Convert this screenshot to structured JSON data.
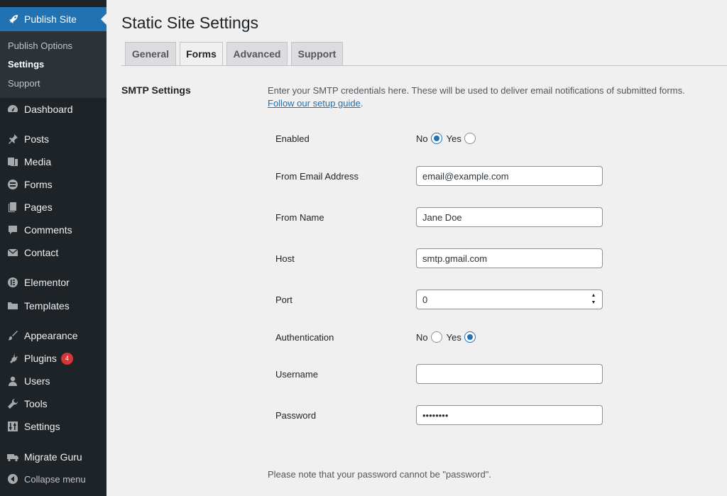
{
  "sidebar": {
    "current": {
      "label": "Publish Site",
      "icon": "rocket-icon"
    },
    "submenu": [
      "Publish Options",
      "Settings",
      "Support"
    ],
    "items": [
      {
        "label": "Dashboard",
        "icon": "dashboard-icon"
      },
      {
        "label": "Posts",
        "icon": "pin-icon"
      },
      {
        "label": "Media",
        "icon": "media-icon"
      },
      {
        "label": "Forms",
        "icon": "forms-icon"
      },
      {
        "label": "Pages",
        "icon": "pages-icon"
      },
      {
        "label": "Comments",
        "icon": "comment-icon"
      },
      {
        "label": "Contact",
        "icon": "mail-icon"
      },
      {
        "label": "Elementor",
        "icon": "elementor-icon"
      },
      {
        "label": "Templates",
        "icon": "folder-icon"
      },
      {
        "label": "Appearance",
        "icon": "brush-icon"
      },
      {
        "label": "Plugins",
        "icon": "plugin-icon",
        "badge": "4"
      },
      {
        "label": "Users",
        "icon": "user-icon"
      },
      {
        "label": "Tools",
        "icon": "wrench-icon"
      },
      {
        "label": "Settings",
        "icon": "sliders-icon"
      },
      {
        "label": "Migrate Guru",
        "icon": "truck-icon"
      },
      {
        "label": "Collapse menu",
        "icon": "collapse-icon"
      }
    ]
  },
  "page": {
    "title": "Static Site Settings",
    "tabs": [
      "General",
      "Forms",
      "Advanced",
      "Support"
    ],
    "active_tab": "Forms"
  },
  "smtp": {
    "section_title": "SMTP Settings",
    "description": "Enter your SMTP credentials here. These will be used to deliver email notifications of submitted forms.",
    "guide_link": "Follow our setup guide",
    "guide_suffix": ".",
    "enabled": {
      "label": "Enabled",
      "no": "No",
      "yes": "Yes",
      "value": "No"
    },
    "from_email": {
      "label": "From Email Address",
      "value": "email@example.com"
    },
    "from_name": {
      "label": "From Name",
      "value": "Jane Doe"
    },
    "host": {
      "label": "Host",
      "value": "smtp.gmail.com"
    },
    "port": {
      "label": "Port",
      "value": "0"
    },
    "authentication": {
      "label": "Authentication",
      "no": "No",
      "yes": "Yes",
      "value": "Yes"
    },
    "username": {
      "label": "Username",
      "value": ""
    },
    "password": {
      "label": "Password",
      "value": "password"
    },
    "note": "Please note that your password cannot be \"password\"."
  },
  "colors": {
    "accent": "#2271b1",
    "sidebar_bg": "#1d2327",
    "badge": "#d63638"
  }
}
